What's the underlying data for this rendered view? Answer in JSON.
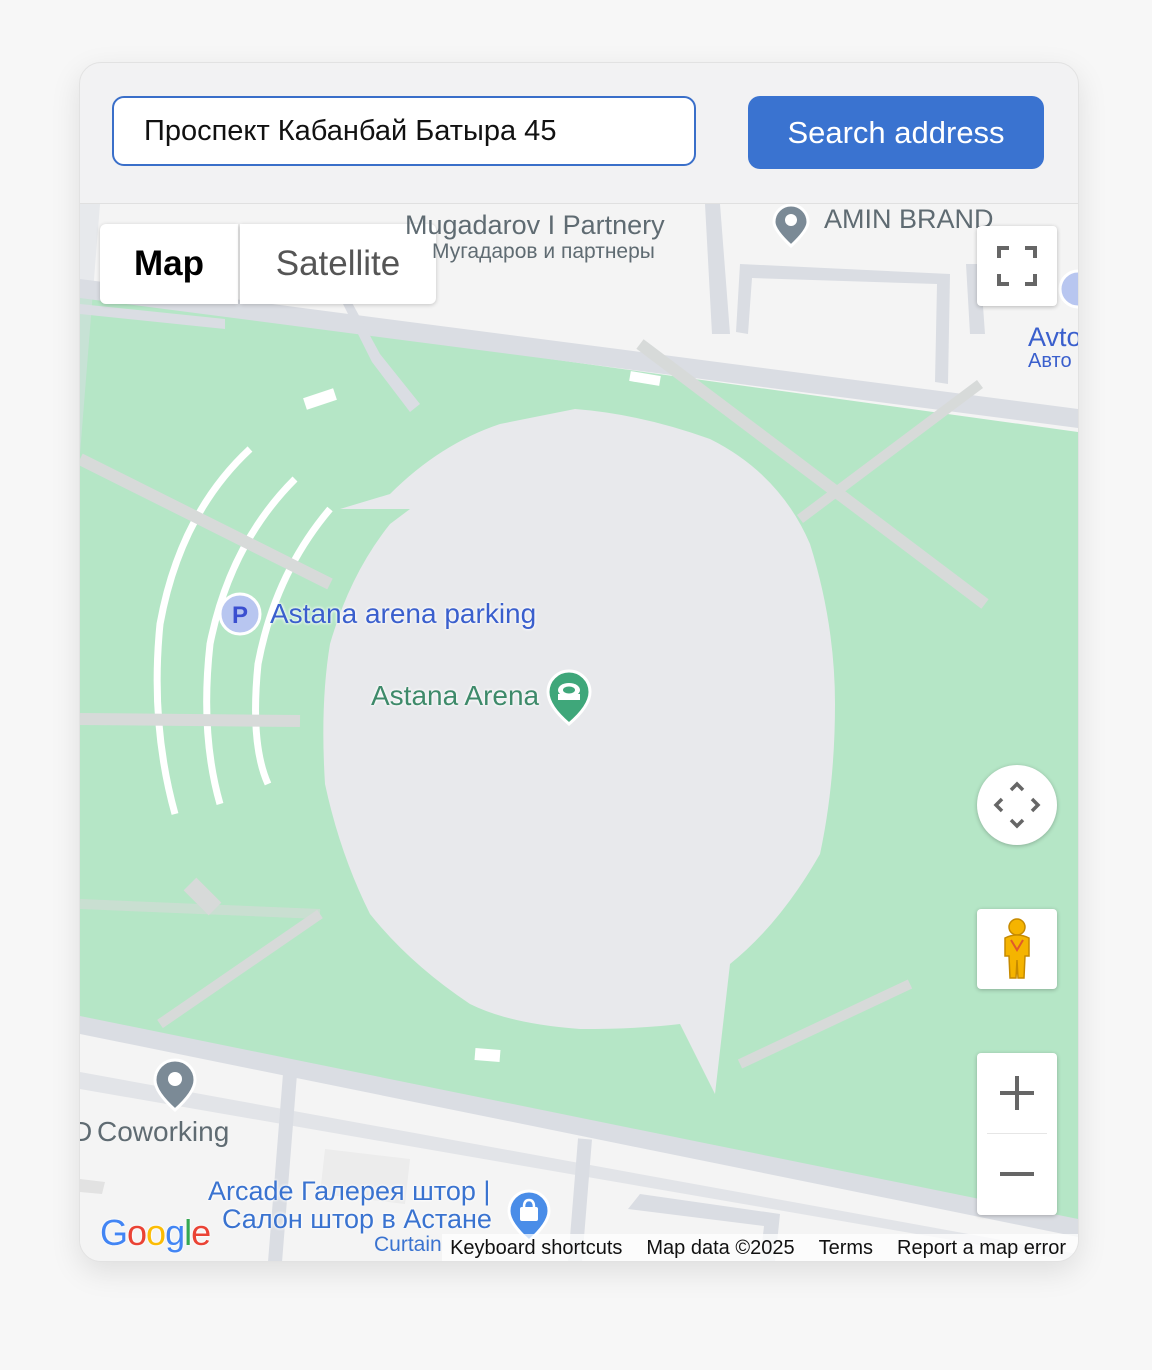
{
  "search": {
    "value": "Проспект Кабанбай Батыра 45",
    "button_label": "Search address"
  },
  "map_type": {
    "map_label": "Map",
    "satellite_label": "Satellite",
    "selected": "Map"
  },
  "places": {
    "mugadarov_en": "Mugadarov I Partnery",
    "mugadarov_ru": "Мугадаров и партнеры",
    "amin_brand": "AMIN BRAND",
    "avto_en": "Avto",
    "avto_ru": "Авто",
    "arena_parking": "Astana arena parking",
    "astana_arena": "Astana Arena",
    "coworking": "Coworking",
    "coworking_prefix": "D",
    "arcade_line1": "Arcade Галерея штор |",
    "arcade_line2": "Салон штор в Астане",
    "curtain": "Curtain"
  },
  "parking_glyph": "P",
  "footer": {
    "keyboard": "Keyboard shortcuts",
    "map_data": "Map data ©2025",
    "terms": "Terms",
    "report": "Report a map error"
  },
  "logo": "Google",
  "colors": {
    "park_green": "#b5e6c6",
    "arena_gray": "#e8e9ec",
    "road": "#dadde3",
    "button_blue": "#3a73d0",
    "poi_blue": "#3a5fcd",
    "poi_green": "#3e8a6a"
  },
  "icons": [
    "fullscreen-icon",
    "camera-control-icon",
    "pegman-icon",
    "zoom-in-icon",
    "zoom-out-icon",
    "parking-icon",
    "stadium-icon",
    "map-pin-icon",
    "shopping-bag-icon"
  ]
}
